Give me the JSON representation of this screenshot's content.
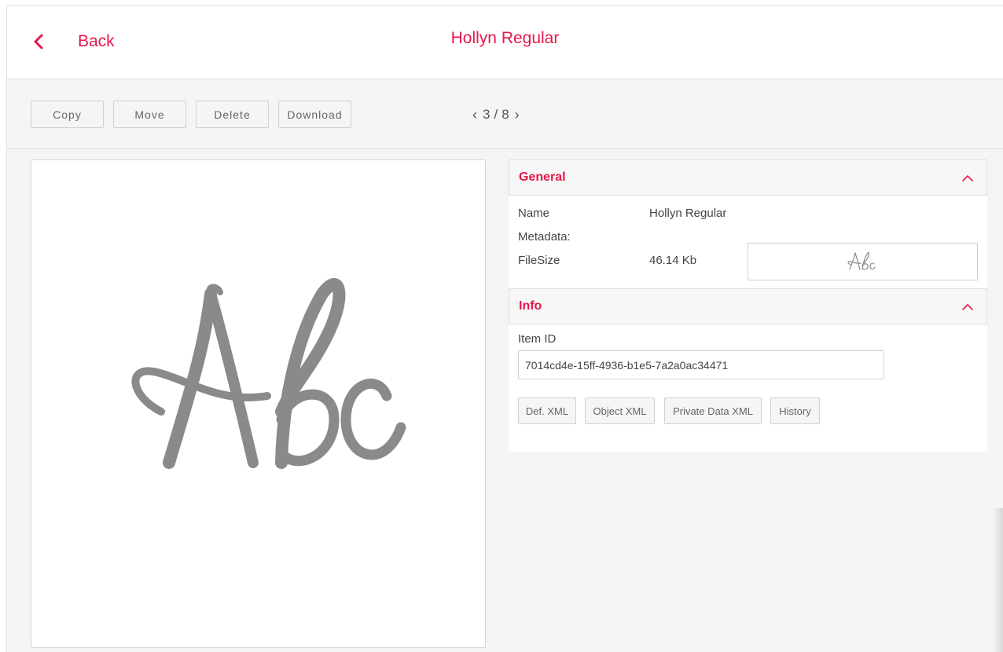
{
  "header": {
    "back_label": "Back",
    "title": "Hollyn Regular"
  },
  "toolbar": {
    "buttons": [
      "Copy",
      "Move",
      "Delete",
      "Download"
    ],
    "pager": {
      "current": "3",
      "separator": "/",
      "total": "8"
    }
  },
  "preview": {
    "glyph_text": "Abc",
    "glyph_color": "#8a8a8a"
  },
  "general": {
    "title": "General",
    "name_label": "Name",
    "name_value": "Hollyn Regular",
    "metadata_label": "Metadata:",
    "filesize_label": "FileSize",
    "filesize_value": "46.14 Kb",
    "thumbnail_text": "Abc"
  },
  "info": {
    "title": "Info",
    "item_id_label": "Item ID",
    "item_id_value": "7014cd4e-15ff-4936-b1e5-7a2a0ac34471",
    "buttons": [
      "Def. XML",
      "Object XML",
      "Private Data XML",
      "History"
    ]
  },
  "colors": {
    "accent": "#e8174a",
    "background": "#f5f5f5",
    "panel": "#ffffff"
  },
  "icons": {
    "back": "chevron-left-icon",
    "collapse": "chevron-up-icon",
    "prev": "chevron-left-icon",
    "next": "chevron-right-icon"
  }
}
